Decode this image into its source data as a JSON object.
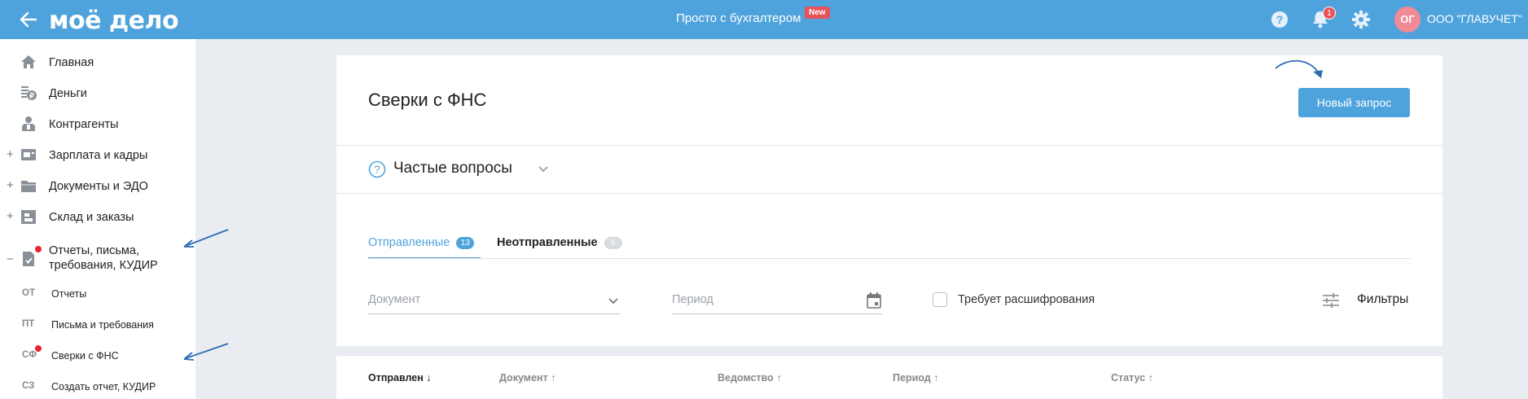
{
  "header": {
    "logo": "моё дело",
    "promo_text": "Просто с бухгалтером",
    "promo_badge": "New",
    "notifications_count": "1",
    "avatar_initials": "ОГ",
    "company_name": "ООО \"ГЛАВУЧЕТ\"",
    "icons": [
      "back-arrow-icon",
      "help-icon",
      "bell-icon",
      "gear-icon"
    ],
    "colors": {
      "brand": "#4fa3dc",
      "badge": "#e8525a",
      "avatar": "#f08a93"
    }
  },
  "sidebar": {
    "items": [
      {
        "label": "Главная",
        "icon": "home-icon",
        "expandable": false
      },
      {
        "label": "Деньги",
        "icon": "money-icon",
        "expandable": false
      },
      {
        "label": "Контрагенты",
        "icon": "contractors-icon",
        "expandable": false
      },
      {
        "label": "Зарплата и кадры",
        "icon": "salary-icon",
        "expandable": true,
        "toggle": "+"
      },
      {
        "label": "Документы и ЭДО",
        "icon": "folder-icon",
        "expandable": true,
        "toggle": "+"
      },
      {
        "label": "Склад и заказы",
        "icon": "warehouse-icon",
        "expandable": true,
        "toggle": "+"
      },
      {
        "label": "Отчеты, письма, требования, КУДИР",
        "icon": "report-icon",
        "expandable": true,
        "toggle": "−",
        "has_dot": true
      }
    ],
    "subitems": [
      {
        "abbr": "ОТ",
        "label": "Отчеты"
      },
      {
        "abbr": "ПТ",
        "label": "Письма и требования"
      },
      {
        "abbr": "СФ",
        "label": "Сверки с ФНС",
        "has_dot": true
      },
      {
        "abbr": "СЗ",
        "label": "Создать отчет, КУДИР"
      }
    ]
  },
  "main": {
    "title": "Сверки с ФНС",
    "new_request_label": "Новый запрос",
    "faq_label": "Частые вопросы",
    "tabs": [
      {
        "label": "Отправленные",
        "count": "13",
        "active": true
      },
      {
        "label": "Неотправленные",
        "count": "6",
        "active": false
      }
    ],
    "filters": {
      "document_placeholder": "Документ",
      "period_placeholder": "Период",
      "needs_decryption_label": "Требует расшифрования",
      "filters_label": "Фильтры"
    },
    "table": {
      "columns": [
        {
          "label": "Отправлен",
          "sort": "↓",
          "active": true
        },
        {
          "label": "Документ",
          "sort": "↑",
          "active": false
        },
        {
          "label": "Ведомство",
          "sort": "↑",
          "active": false
        },
        {
          "label": "Период",
          "sort": "↑",
          "active": false
        },
        {
          "label": "Статус",
          "sort": "↑",
          "active": false
        }
      ]
    }
  }
}
